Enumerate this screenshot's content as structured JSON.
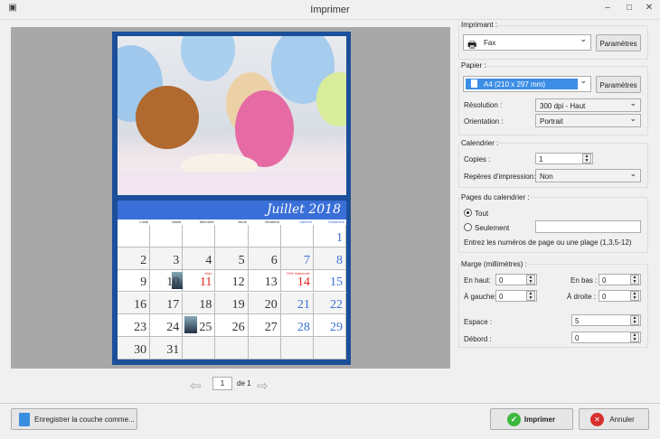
{
  "window": {
    "title": "Imprimer"
  },
  "calendar": {
    "month_title": "Juillet 2018",
    "weekdays": [
      "Lundi",
      "Mardi",
      "Mercredi",
      "Jeudi",
      "Vendredi",
      "Samedi",
      "Dimanche"
    ],
    "weeks": [
      [
        "",
        "",
        "",
        "",
        "",
        "",
        "1"
      ],
      [
        "2",
        "3",
        "4",
        "5",
        "6",
        "7",
        "8"
      ],
      [
        "9",
        "10",
        "11",
        "12",
        "13",
        "14",
        "15"
      ],
      [
        "16",
        "17",
        "18",
        "19",
        "20",
        "21",
        "22"
      ],
      [
        "23",
        "24",
        "25",
        "26",
        "27",
        "28",
        "29"
      ],
      [
        "30",
        "31",
        "",
        "",
        "",
        "",
        ""
      ]
    ],
    "events": [
      {
        "day": "11",
        "text": "Alan"
      },
      {
        "day": "14",
        "text": "Fête Nationale"
      }
    ],
    "colors": {
      "header": "#3a6fd8",
      "weekend": "#3a6fd8",
      "holiday": "#e32626",
      "frame": "#1b4f9a"
    }
  },
  "pager": {
    "current": "1",
    "of_label": "de 1"
  },
  "printer": {
    "group_label": "Imprimant :",
    "selected": "Fax",
    "settings_label": "Paramètres"
  },
  "paper": {
    "group_label": "Papier :",
    "selected": "A4 (210 x 297 mm)",
    "settings_label": "Paramètres",
    "resolution_label": "Résolution :",
    "resolution_value": "300 dpi - Haut",
    "orientation_label": "Orientation :",
    "orientation_value": "Portrait"
  },
  "calendar_opts": {
    "group_label": "Calendrier :",
    "copies_label": "Copies :",
    "copies_value": "1",
    "marks_label": "Repères d'impression:",
    "marks_value": "Non"
  },
  "pages": {
    "group_label": "Pages du calendrier :",
    "all_label": "Tout",
    "only_label": "Seulement",
    "only_value": "",
    "hint": "Entrez les numéros de page ou une plage (1,3,5-12)"
  },
  "margins": {
    "group_label": "Marge (millimètres) :",
    "top_label": "En haut:",
    "top_value": "0",
    "bottom_label": "En bas :",
    "bottom_value": "0",
    "left_label": "À gauche:",
    "left_value": "0",
    "right_label": "À droite :",
    "right_value": "0",
    "space_label": "Espace :",
    "space_value": "5",
    "bleed_label": "Débord :",
    "bleed_value": "0"
  },
  "footer": {
    "save_layer_label": "Enregistrer la couche comme...",
    "print_label": "Imprimer",
    "cancel_label": "Annuler"
  }
}
